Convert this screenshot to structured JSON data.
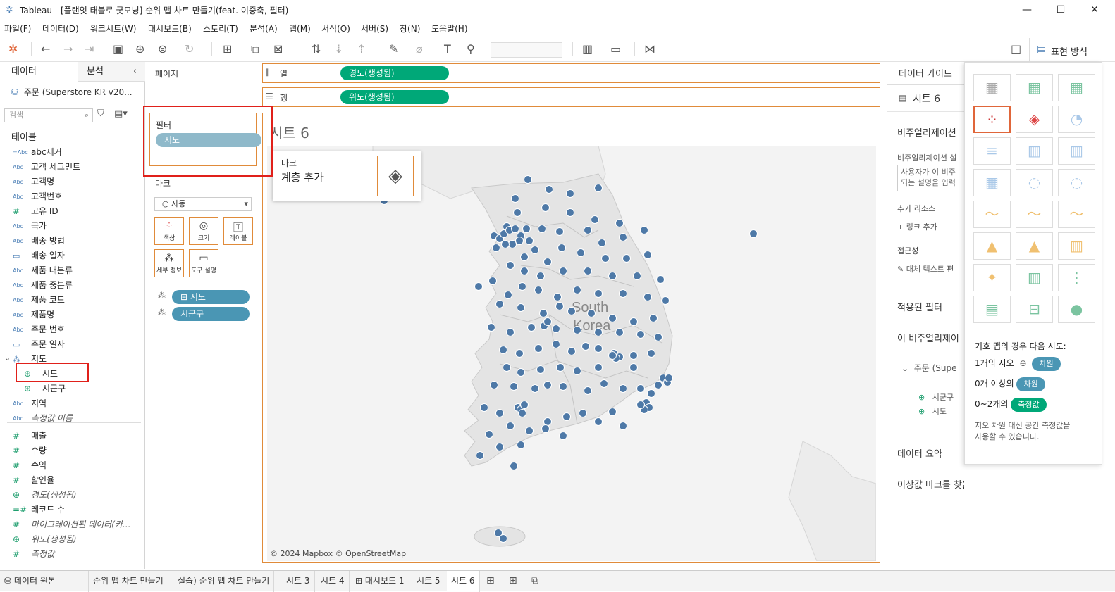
{
  "window": {
    "title": "Tableau - [플랜잇 태블로 굿모닝] 순위 맵 차트 만들기(feat. 이중축, 필터)"
  },
  "menu": [
    "파일(F)",
    "데이터(D)",
    "워크시트(W)",
    "대시보드(B)",
    "스토리(T)",
    "분석(A)",
    "맵(M)",
    "서식(O)",
    "서버(S)",
    "창(N)",
    "도움말(H)"
  ],
  "toolbar": {
    "showme_label": "표현 방식"
  },
  "left": {
    "tab_data": "데이터",
    "tab_analysis": "분석",
    "datasource": "주문 (Superstore KR v20...",
    "search_placeholder": "검색",
    "tables_header": "테이블",
    "fields": [
      {
        "icon": "=Abc",
        "name": "abc제거",
        "italic": false
      },
      {
        "icon": "Abc",
        "name": "고객 세그먼트",
        "italic": false
      },
      {
        "icon": "Abc",
        "name": "고객명",
        "italic": false
      },
      {
        "icon": "Abc",
        "name": "고객번호",
        "italic": false
      },
      {
        "icon": "#",
        "name": "고유 ID",
        "italic": false
      },
      {
        "icon": "Abc",
        "name": "국가",
        "italic": false
      },
      {
        "icon": "Abc",
        "name": "배송 방법",
        "italic": false
      },
      {
        "icon": "cal",
        "name": "배송 일자",
        "italic": false
      },
      {
        "icon": "Abc",
        "name": "제품 대분류",
        "italic": false
      },
      {
        "icon": "Abc",
        "name": "제품 중분류",
        "italic": false
      },
      {
        "icon": "Abc",
        "name": "제품 코드",
        "italic": false
      },
      {
        "icon": "Abc",
        "name": "제품명",
        "italic": false
      },
      {
        "icon": "Abc",
        "name": "주문 번호",
        "italic": false
      },
      {
        "icon": "cal",
        "name": "주문 일자",
        "italic": false
      },
      {
        "icon": "hier",
        "name": "지도",
        "italic": false
      },
      {
        "icon": "globe",
        "name": "시도",
        "italic": false
      },
      {
        "icon": "globe",
        "name": "시군구",
        "italic": false
      },
      {
        "icon": "Abc",
        "name": "지역",
        "italic": false
      },
      {
        "icon": "Abc",
        "name": "측정값 이름",
        "italic": true
      },
      {
        "icon": "#",
        "name": "매출",
        "italic": false
      },
      {
        "icon": "#",
        "name": "수량",
        "italic": false
      },
      {
        "icon": "#",
        "name": "수익",
        "italic": false
      },
      {
        "icon": "#",
        "name": "할인율",
        "italic": false
      },
      {
        "icon": "globe",
        "name": "경도(생성됨)",
        "italic": true
      },
      {
        "icon": "=#",
        "name": "레코드 수",
        "italic": false
      },
      {
        "icon": "#",
        "name": "마이그레이션된 데이터(카...",
        "italic": true
      },
      {
        "icon": "globe",
        "name": "위도(생성됨)",
        "italic": true
      },
      {
        "icon": "#",
        "name": "측정값",
        "italic": true
      }
    ]
  },
  "cards": {
    "pages": "페이지",
    "filters": "필터",
    "filter_pill": "시도",
    "marks": "마크",
    "mark_type": "자동",
    "mark_buttons": [
      "색상",
      "크기",
      "레이블",
      "세부 정보",
      "도구 설명"
    ],
    "mark_pills": [
      "시도",
      "시군구"
    ]
  },
  "shelves": {
    "columns_label": "열",
    "columns_pill": "경도(생성됨)",
    "rows_label": "행",
    "rows_pill": "위도(생성됨)"
  },
  "viz": {
    "sheet_title": "시트 6",
    "layer_popup_title": "마크",
    "layer_popup_action": "계층 추가",
    "map_label_1": "South",
    "map_label_2": "Korea",
    "attribution": "© 2024 Mapbox © OpenStreetMap"
  },
  "guide": {
    "header": "데이터 가이드",
    "sheet": "시트 6",
    "viz_desc_header": "비주얼리제이션",
    "viz_desc_sub": "비주얼리제이션 설",
    "desc_box_line1": "사용자가 이 비주",
    "desc_box_line2": "되는 설명을 입력",
    "resources": "추가 리소스",
    "add_link": "링크 추가",
    "accessibility": "접근성",
    "alt_text": "대체 텍스트 편",
    "applied_filters": "적용된 필터",
    "this_viz": "이 비주얼리제이",
    "datasource_short": "주문 (Supe",
    "field1": "시군구",
    "field2": "시도",
    "data_summary": "데이터 요약",
    "outliers": "이상값 마크를 찾을 수 없음"
  },
  "showme": {
    "hint_title": "기호 맵의 경우 다음 시도:",
    "req1_text": "1개의 지오",
    "req1_pill": "차원",
    "req2_text": "0개 이상의",
    "req2_pill": "차원",
    "req3_text": "0~2개의",
    "req3_pill": "측정값",
    "note_line1": "지오 차원 대신 공간 측정값을",
    "note_line2": "사용할 수 있습니다."
  },
  "tabs": [
    "데이터 원본",
    "순위 맵 차트 만들기",
    "실습) 순위 맵 차트 만들기",
    "시트 3",
    "시트 4",
    "대시보드 1",
    "시트 5",
    "시트 6"
  ],
  "colors": {
    "accent": "#e08b3a",
    "dim_pill": "#4a96b4",
    "measure_pill": "#00a878",
    "dot": "#4e79a7",
    "highlight": "#e0201a"
  }
}
